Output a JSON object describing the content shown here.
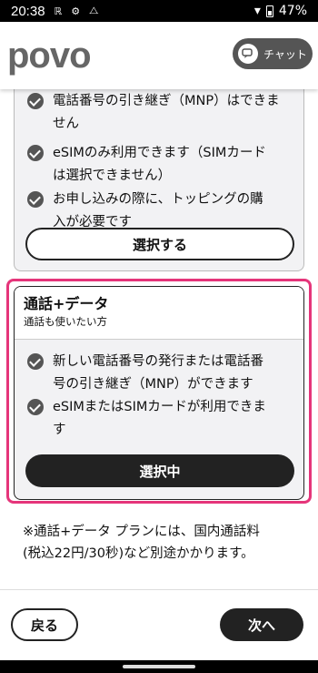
{
  "status": {
    "time": "20:38",
    "battery": "47%"
  },
  "header": {
    "logo": "povo",
    "chat_label": "チャット"
  },
  "plan_top": {
    "features": [
      "電話番号の引き継ぎ（MNP）はできま\nせん",
      "eSIMのみ利用できます（SIMカード\nは選択できません）",
      "お申し込みの際に、トッピングの購\n入が必要です"
    ],
    "button": "選択する"
  },
  "plan_selected": {
    "name": "通話+データ",
    "subtitle": "通話も使いたい方",
    "features": [
      "新しい電話番号の発行または電話番\n号の引き継ぎ（MNP）ができます",
      "eSIMまたはSIMカードが利用できま\nす"
    ],
    "button": "選択中",
    "highlight_color": "#e5357a"
  },
  "note": "※通話+データ プランには、国内通話料\n(税込22円/30秒)など別途かかります。",
  "footer": {
    "back": "戻る",
    "next": "次へ"
  }
}
